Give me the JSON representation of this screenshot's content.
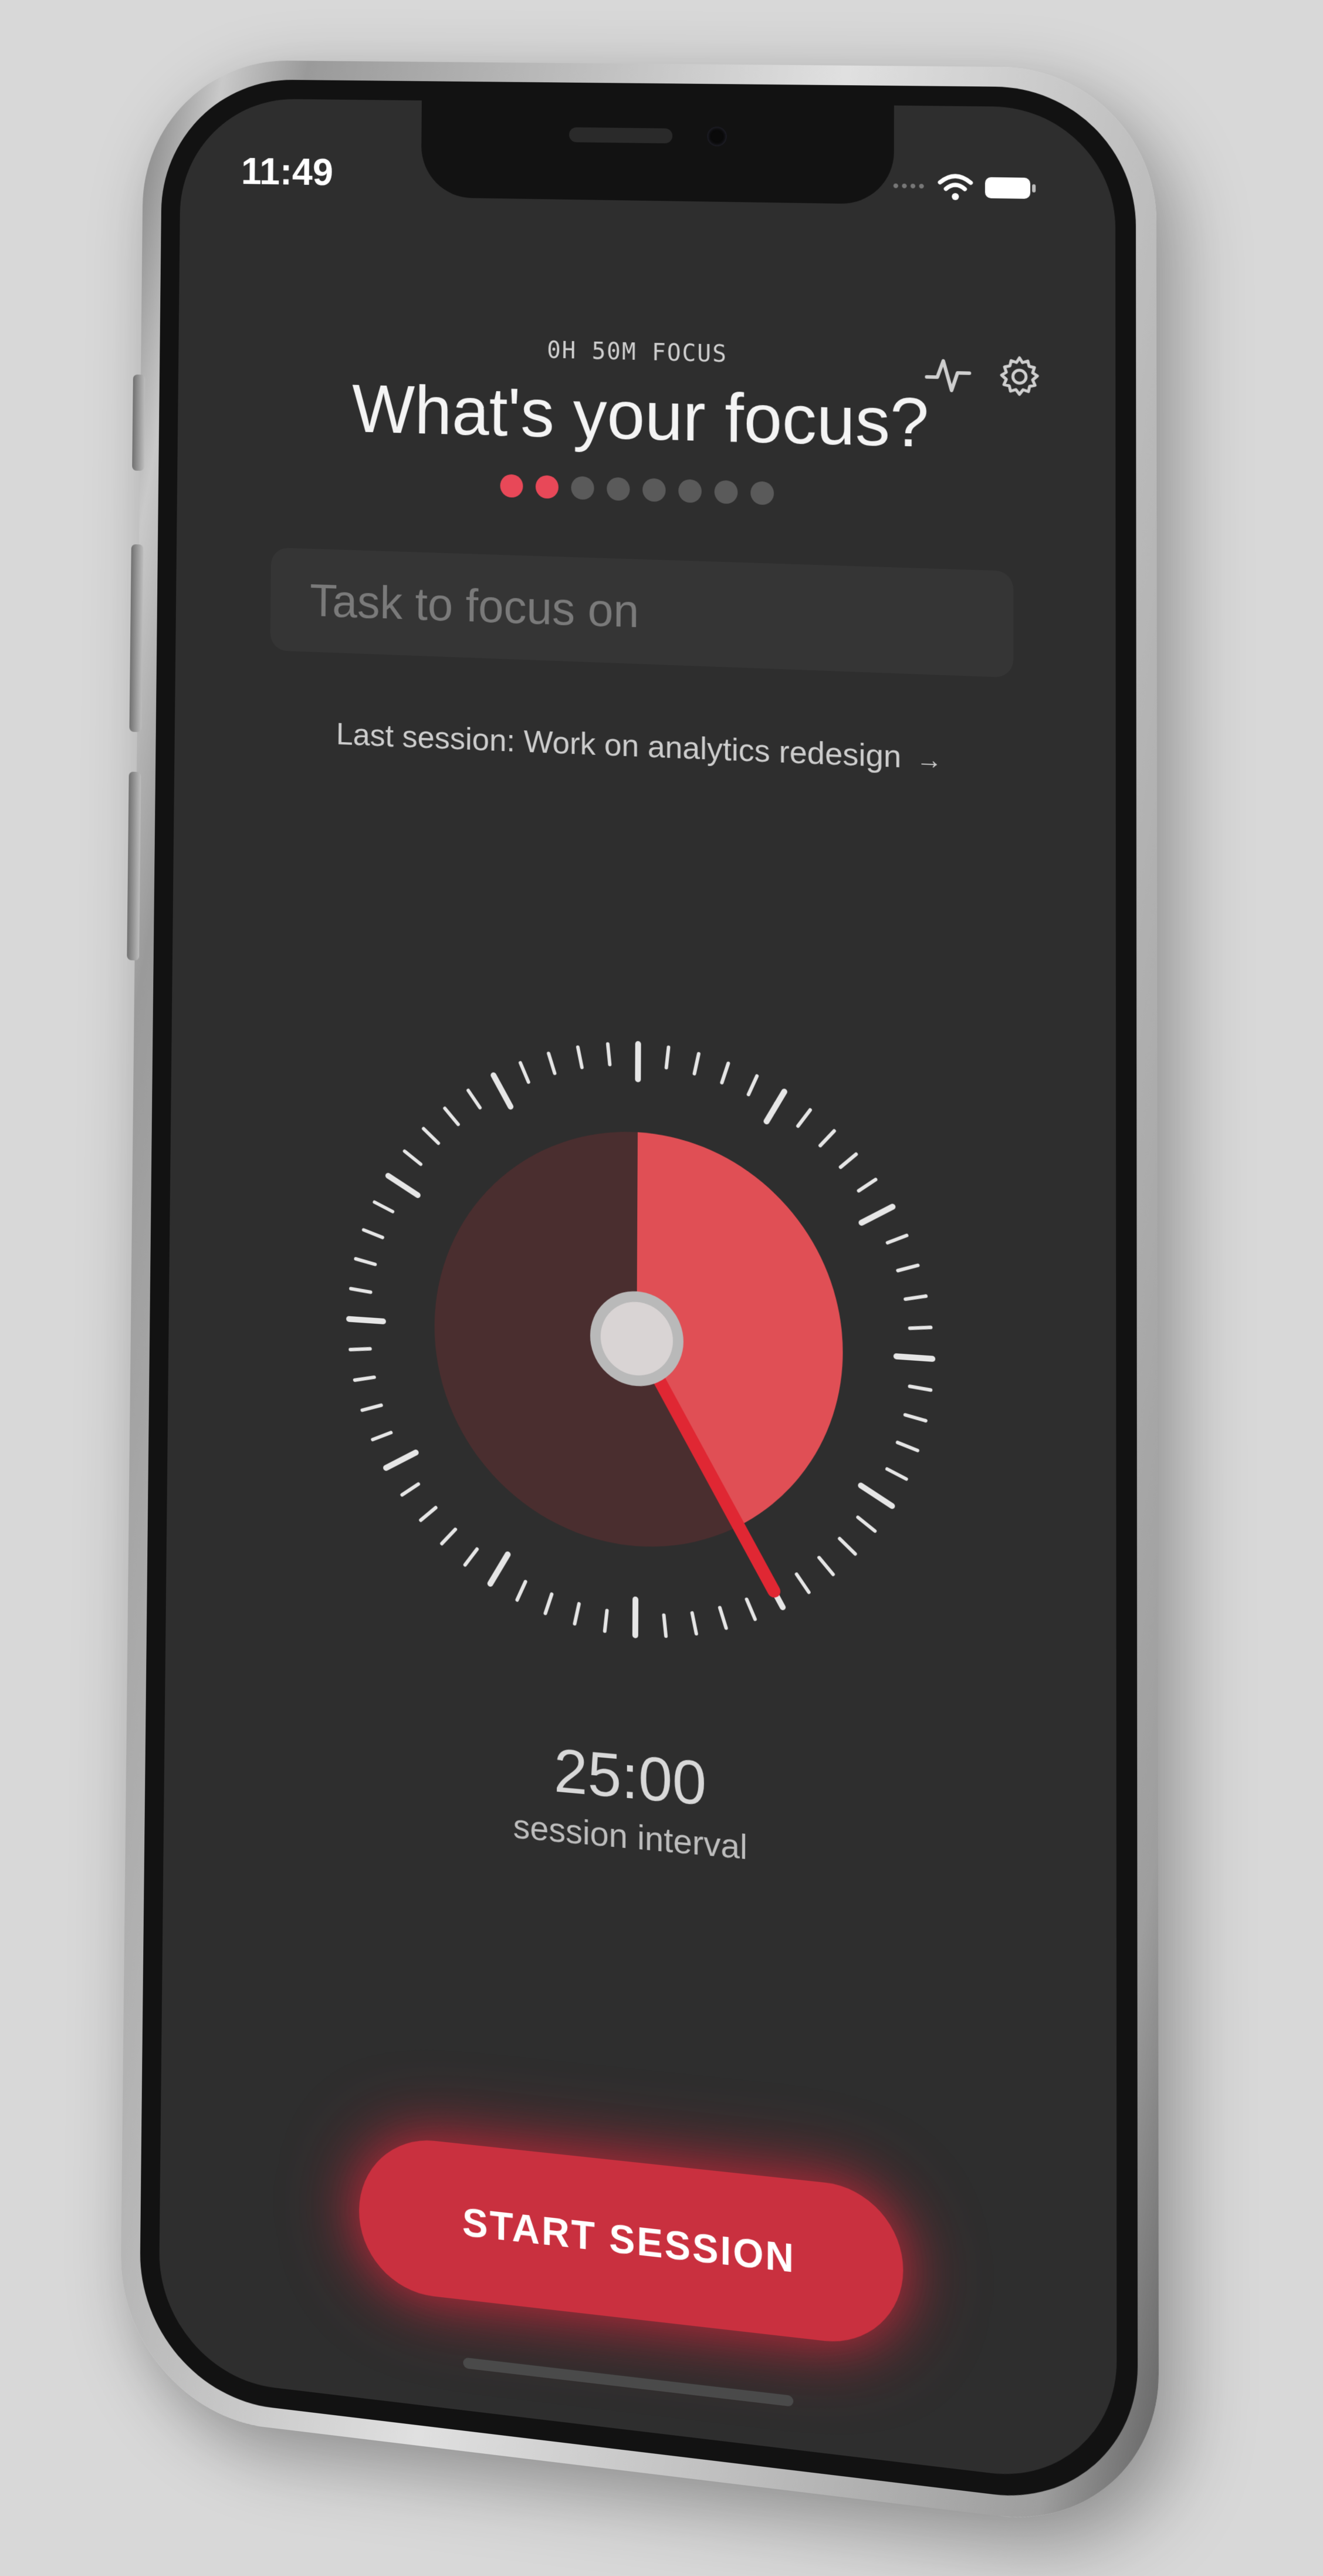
{
  "status_bar": {
    "time": "11:49"
  },
  "header": {
    "focus_summary": "0H 50M FOCUS",
    "title": "What's your focus?",
    "total_steps": 8,
    "active_steps": 2,
    "stats_icon": "activity-icon",
    "settings_icon": "gear-icon"
  },
  "task": {
    "placeholder": "Task to focus on",
    "value": ""
  },
  "last_session": {
    "text": "Last session: Work on analytics redesign",
    "arrow": "→"
  },
  "timer": {
    "value": "25:00",
    "label": "session interval",
    "interval_minutes": 25,
    "dial_max_minutes": 60
  },
  "start_button": {
    "label": "START SESSION"
  },
  "colors": {
    "accent": "#e84858",
    "button": "#c9303f",
    "background": "#2e2e2e",
    "dial_face": "#4a2e2f",
    "dial_fill": "#e04f55"
  }
}
